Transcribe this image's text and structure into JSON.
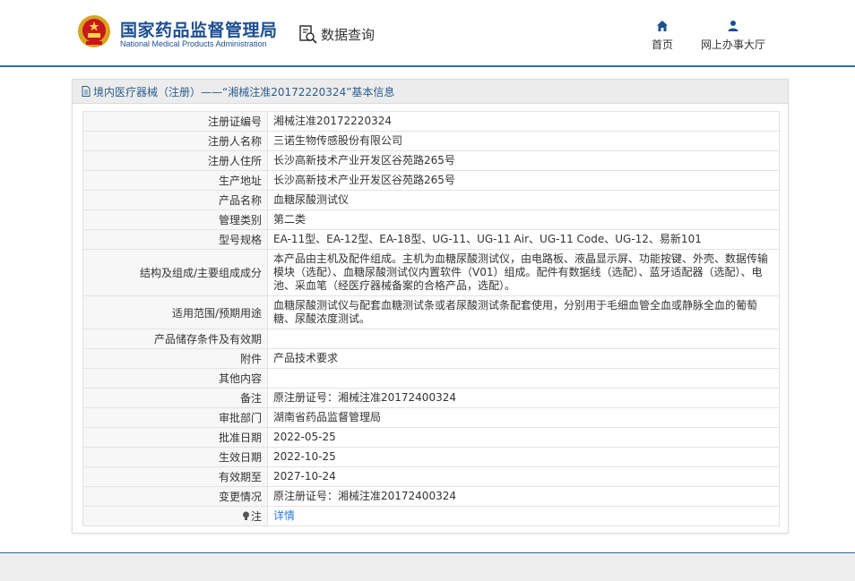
{
  "header": {
    "title_cn": "国家药品监督管理局",
    "title_en": "National Medical Products Administration",
    "query_label": "数据查询",
    "nav": [
      {
        "label": "首页",
        "icon": "home-icon"
      },
      {
        "label": "网上办事大厅",
        "icon": "user-icon"
      }
    ]
  },
  "panel": {
    "heading": "境内医疗器械（注册）——“湘械注准20172220324”基本信息",
    "rows": [
      {
        "key": "注册证编号",
        "value": "湘械注准20172220324"
      },
      {
        "key": "注册人名称",
        "value": "三诺生物传感股份有限公司"
      },
      {
        "key": "注册人住所",
        "value": "长沙高新技术产业开发区谷苑路265号"
      },
      {
        "key": "生产地址",
        "value": "长沙高新技术产业开发区谷苑路265号"
      },
      {
        "key": "产品名称",
        "value": "血糖尿酸测试仪"
      },
      {
        "key": "管理类别",
        "value": "第二类"
      },
      {
        "key": "型号规格",
        "value": "EA-11型、EA-12型、EA-18型、UG-11、UG-11 Air、UG-11 Code、UG-12、易新101"
      },
      {
        "key": "结构及组成/主要组成成分",
        "value": "本产品由主机及配件组成。主机为血糖尿酸测试仪，由电路板、液晶显示屏、功能按键、外壳、数据传输模块（选配）、血糖尿酸测试仪内置软件（V01）组成。配件有数据线（选配）、蓝牙适配器（选配）、电池、采血笔（经医疗器械备案的合格产品，选配）。"
      },
      {
        "key": "适用范围/预期用途",
        "value": "血糖尿酸测试仪与配套血糖测试条或者尿酸测试条配套使用，分别用于毛细血管全血或静脉全血的葡萄糖、尿酸浓度测试。"
      },
      {
        "key": "产品储存条件及有效期",
        "value": ""
      },
      {
        "key": "附件",
        "value": "产品技术要求"
      },
      {
        "key": "其他内容",
        "value": ""
      },
      {
        "key": "备注",
        "value": "原注册证号：湘械注准20172400324"
      },
      {
        "key": "审批部门",
        "value": "湖南省药品监督管理局"
      },
      {
        "key": "批准日期",
        "value": "2022-05-25"
      },
      {
        "key": "生效日期",
        "value": "2022-10-25"
      },
      {
        "key": "有效期至",
        "value": "2027-10-24"
      },
      {
        "key": "变更情况",
        "value": "原注册证号：湘械注准20172400324"
      }
    ],
    "note_key": "注",
    "note_link": "详情"
  },
  "colors": {
    "brand": "#1d4f91",
    "link": "#2b7bd0",
    "header_line": "#2b6e9c"
  }
}
